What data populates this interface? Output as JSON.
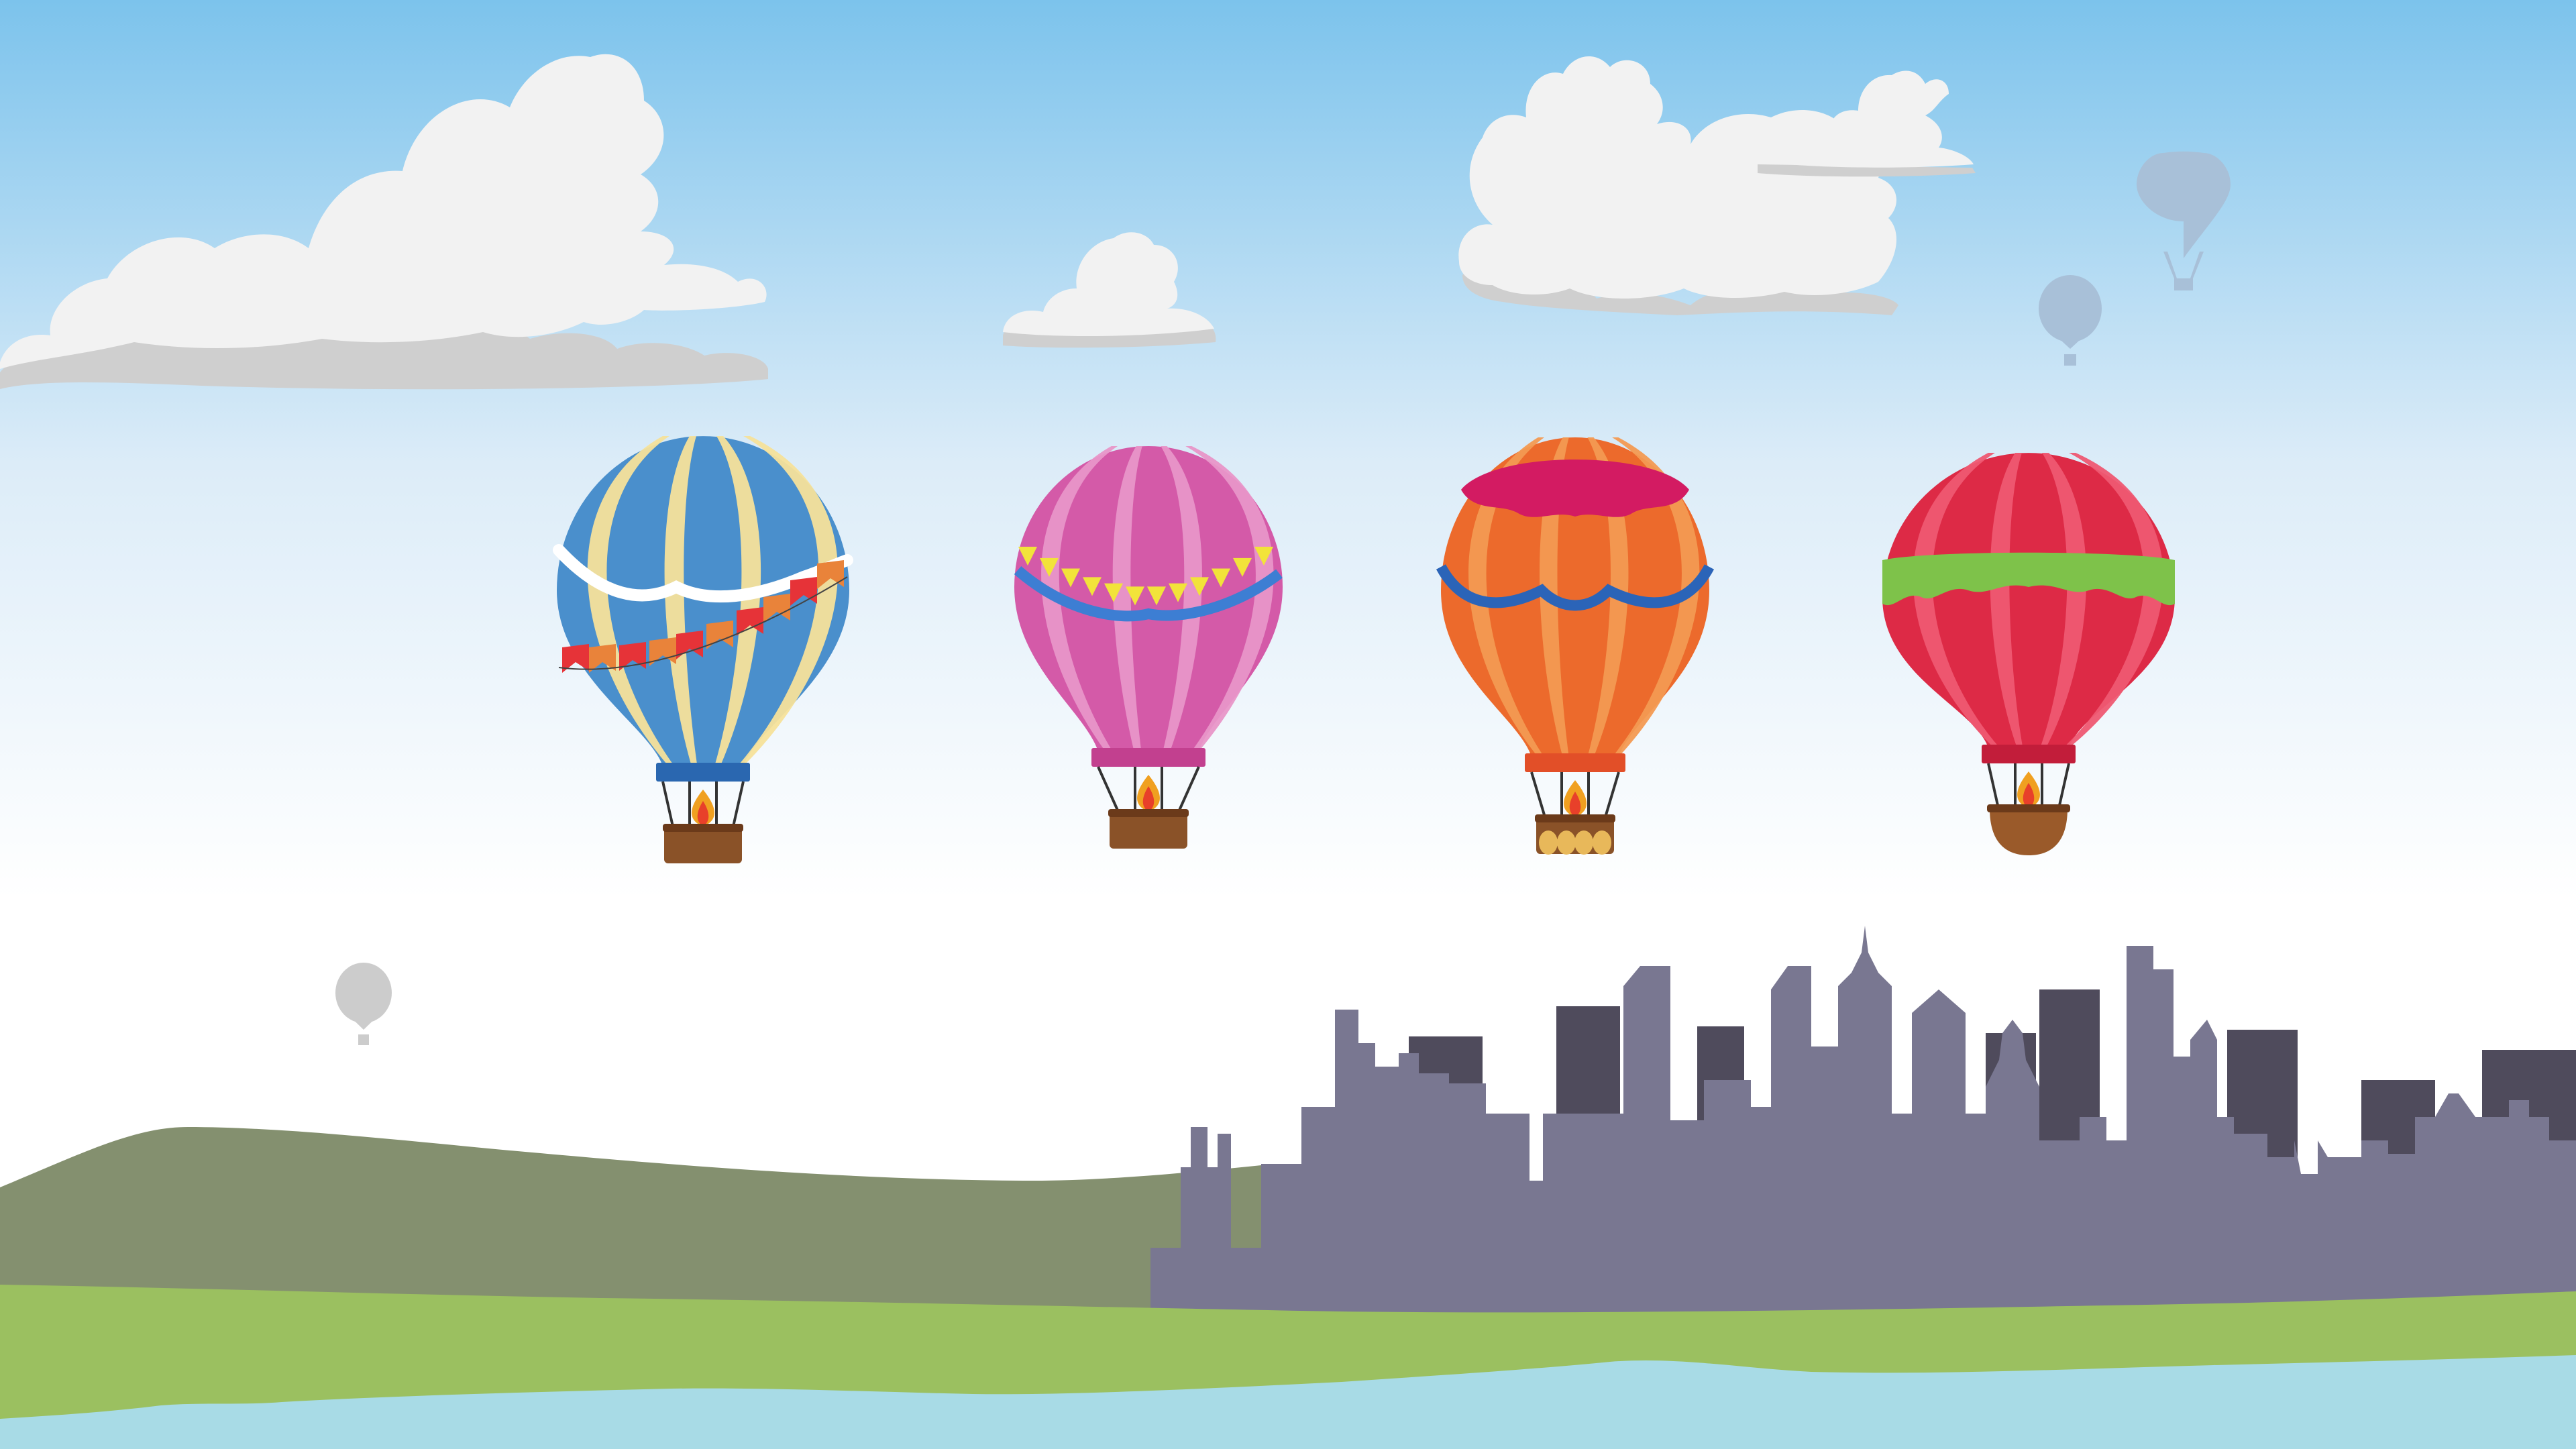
{
  "scene": {
    "colors": {
      "sky_top": "#7cc3ec",
      "sky_mid": "#dcecf8",
      "sky_bottom": "#ffffff",
      "cloud": "#f2f2f2",
      "cloud_shadow": "#cfcfcf",
      "hill": "#84906f",
      "grass": "#9bc060",
      "water": "#a8dbe6",
      "skyline_front": "#797791",
      "skyline_back": "#4f4b5c",
      "distant_balloon_blue": "#a8c0d8",
      "distant_balloon_gray": "#cccccc"
    },
    "clouds": [
      {
        "name": "cloud-large-left",
        "kind": "large"
      },
      {
        "name": "cloud-small-center",
        "kind": "small"
      },
      {
        "name": "cloud-right",
        "kind": "medium"
      }
    ],
    "balloons": [
      {
        "name": "balloon-blue-striped",
        "stripe_a": "#4a8fcc",
        "stripe_b": "#f6e19a",
        "band": "#2a67b0",
        "decoration": "pennant-flags",
        "flag_colors": [
          "#e63338",
          "#e9833a"
        ],
        "garland": "#ffffff"
      },
      {
        "name": "balloon-pink-striped",
        "stripe_a": "#d45aa8",
        "stripe_b": "#e896c8",
        "band": "#c2408f",
        "decoration": "yellow-pennants-blue-garland",
        "flag_colors": [
          "#f2e33a"
        ],
        "garland": "#3d7ed3"
      },
      {
        "name": "balloon-orange-striped",
        "stripe_a": "#ec6a2c",
        "stripe_b": "#f39a52",
        "band": "#e24f28",
        "decoration": "magenta-top-scallop-blue-garland",
        "flag_colors": [
          "#d31b62"
        ],
        "garland": "#2b64b8"
      },
      {
        "name": "balloon-red-striped",
        "stripe_a": "#dd2a46",
        "stripe_b": "#ee5872",
        "band": "#c21d3a",
        "decoration": "green-scallop",
        "flag_colors": [
          "#7ec24a"
        ],
        "garland": "#7ec24a"
      }
    ],
    "distant_balloons": [
      {
        "name": "distant-balloon-blue-large"
      },
      {
        "name": "distant-balloon-blue-small"
      },
      {
        "name": "distant-balloon-gray"
      }
    ]
  }
}
